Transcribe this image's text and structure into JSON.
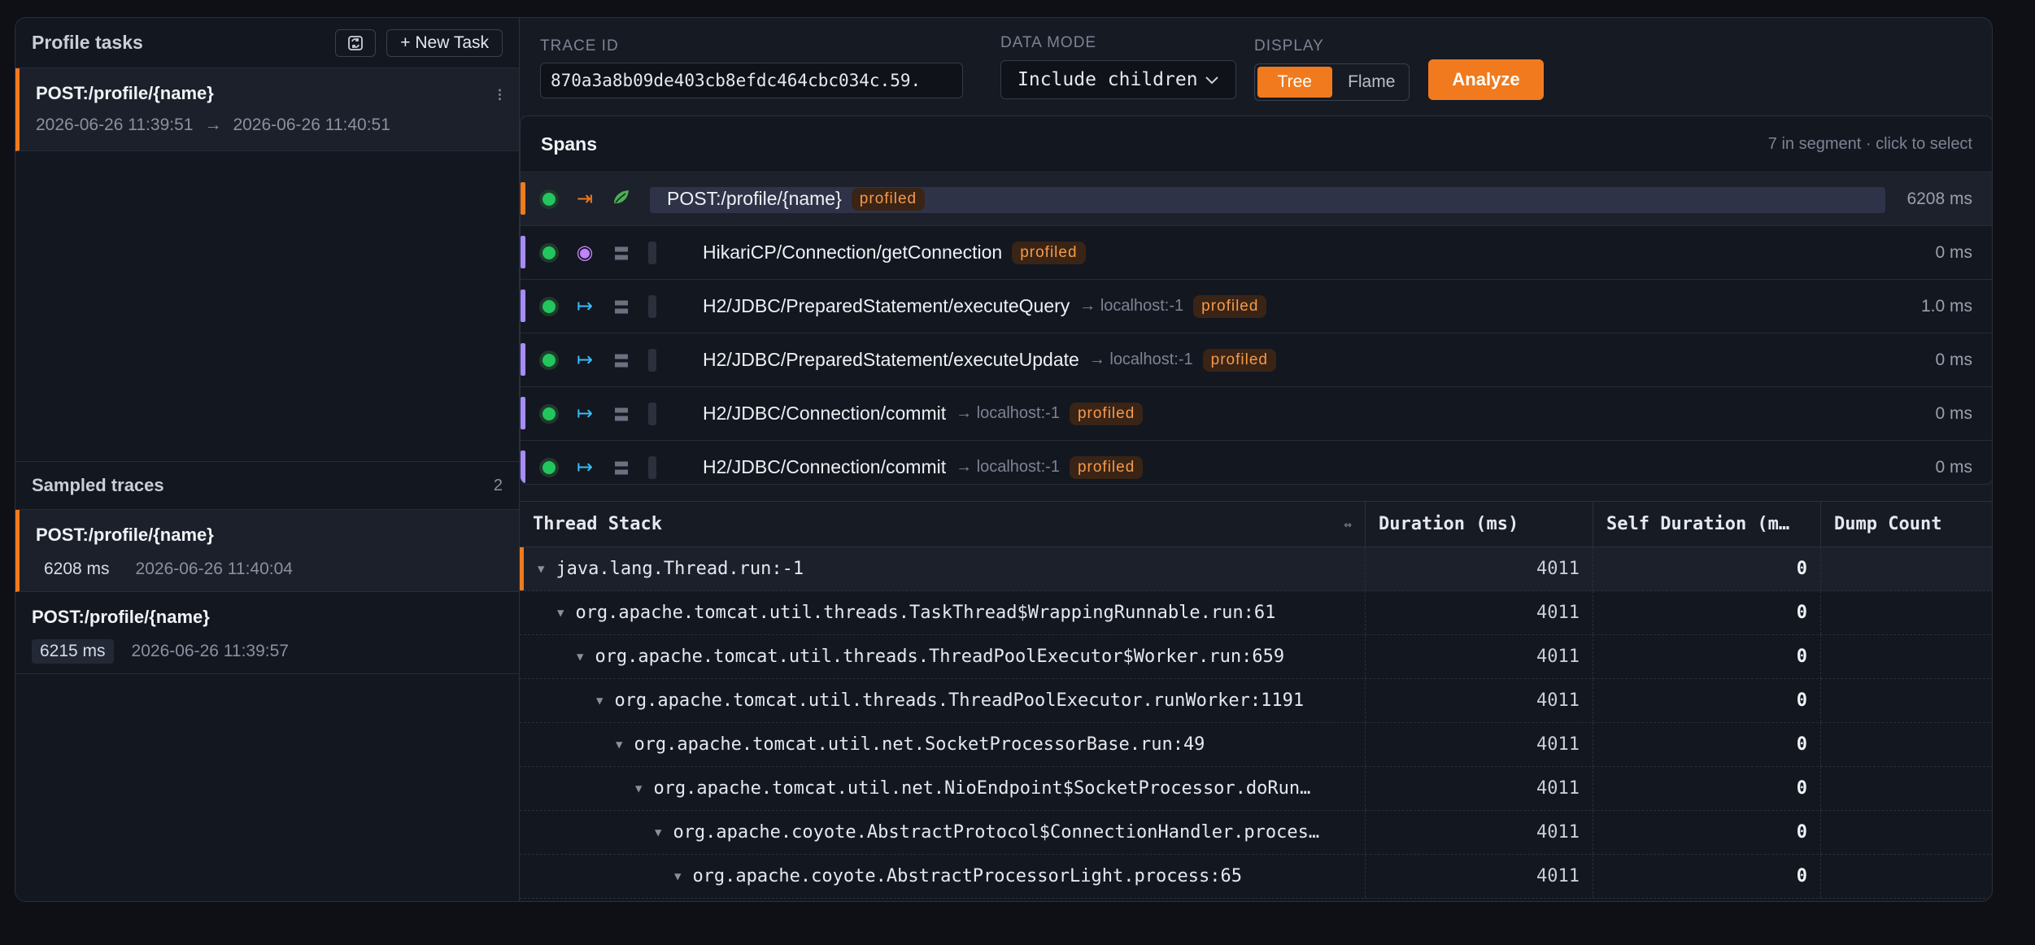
{
  "left": {
    "title": "Profile tasks",
    "new_task_label": "+ New Task",
    "task": {
      "name": "POST:/profile/{name}",
      "start": "2026-06-26 11:39:51",
      "end": "2026-06-26 11:40:51",
      "menu": "⁝"
    },
    "sampled_title": "Sampled traces",
    "sampled_count": "2",
    "traces": [
      {
        "name": "POST:/profile/{name}",
        "duration": "6208 ms",
        "time": "2026-06-26 11:40:04"
      },
      {
        "name": "POST:/profile/{name}",
        "duration": "6215 ms",
        "time": "2026-06-26 11:39:57"
      }
    ]
  },
  "toolbar": {
    "trace_id_label": "TRACE ID",
    "trace_id_value": "870a3a8b09de403cb8efdc464cbc034c.59.",
    "data_mode_label": "DATA MODE",
    "data_mode_value": "Include children",
    "display_label": "DISPLAY",
    "display_tree": "Tree",
    "display_flame": "Flame",
    "analyze_label": "Analyze"
  },
  "spans": {
    "title": "Spans",
    "hint": "7 in segment · click to select",
    "rows": [
      {
        "name": "POST:/profile/{name}",
        "peer": "",
        "badge": "profiled",
        "duration": "6208 ms"
      },
      {
        "name": "HikariCP/Connection/getConnection",
        "peer": "",
        "badge": "profiled",
        "duration": "0 ms"
      },
      {
        "name": "H2/JDBC/PreparedStatement/executeQuery",
        "peer": "→ localhost:-1",
        "badge": "profiled",
        "duration": "1.0 ms"
      },
      {
        "name": "H2/JDBC/PreparedStatement/executeUpdate",
        "peer": "→ localhost:-1",
        "badge": "profiled",
        "duration": "0 ms"
      },
      {
        "name": "H2/JDBC/Connection/commit",
        "peer": "→ localhost:-1",
        "badge": "profiled",
        "duration": "0 ms"
      },
      {
        "name": "H2/JDBC/Connection/commit",
        "peer": "→ localhost:-1",
        "badge": "profiled",
        "duration": "0 ms"
      }
    ]
  },
  "stack": {
    "headers": [
      "Thread Stack",
      "Duration (ms)",
      "Self Duration (m…",
      "Dump Count"
    ],
    "rows": [
      {
        "method": "java.lang.Thread.run:-1",
        "duration": "4011",
        "self": "0",
        "dump": ""
      },
      {
        "method": "org.apache.tomcat.util.threads.TaskThread$WrappingRunnable.run:61",
        "duration": "4011",
        "self": "0",
        "dump": ""
      },
      {
        "method": "org.apache.tomcat.util.threads.ThreadPoolExecutor$Worker.run:659",
        "duration": "4011",
        "self": "0",
        "dump": ""
      },
      {
        "method": "org.apache.tomcat.util.threads.ThreadPoolExecutor.runWorker:1191",
        "duration": "4011",
        "self": "0",
        "dump": ""
      },
      {
        "method": "org.apache.tomcat.util.net.SocketProcessorBase.run:49",
        "duration": "4011",
        "self": "0",
        "dump": ""
      },
      {
        "method": "org.apache.tomcat.util.net.NioEndpoint$SocketProcessor.doRun…",
        "duration": "4011",
        "self": "0",
        "dump": ""
      },
      {
        "method": "org.apache.coyote.AbstractProtocol$ConnectionHandler.proces…",
        "duration": "4011",
        "self": "0",
        "dump": ""
      },
      {
        "method": "org.apache.coyote.AbstractProcessorLight.process:65",
        "duration": "4011",
        "self": "0",
        "dump": ""
      }
    ]
  },
  "colors": {
    "accent": "#f07a1d",
    "ok": "#22c55e",
    "span_bar": "#a78bfa"
  }
}
